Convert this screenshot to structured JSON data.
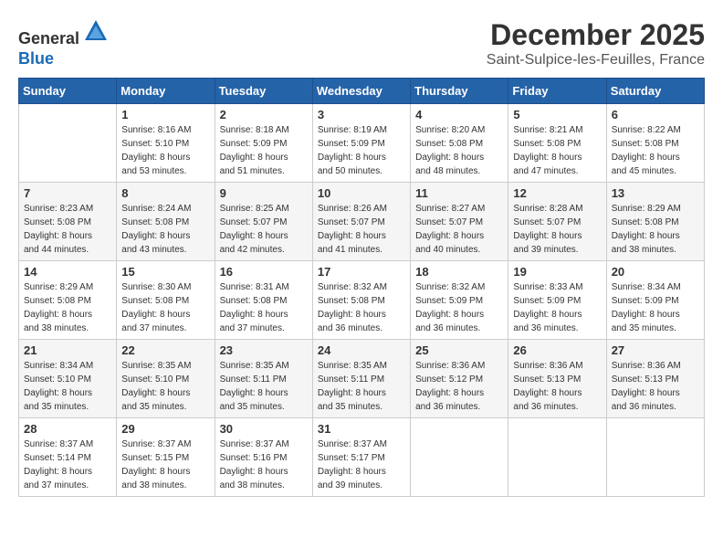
{
  "header": {
    "logo_line1": "General",
    "logo_line2": "Blue",
    "month_title": "December 2025",
    "location": "Saint-Sulpice-les-Feuilles, France"
  },
  "weekdays": [
    "Sunday",
    "Monday",
    "Tuesday",
    "Wednesday",
    "Thursday",
    "Friday",
    "Saturday"
  ],
  "rows": [
    {
      "alt": false,
      "cells": [
        {
          "day": "",
          "info": ""
        },
        {
          "day": "1",
          "info": "Sunrise: 8:16 AM\nSunset: 5:10 PM\nDaylight: 8 hours\nand 53 minutes."
        },
        {
          "day": "2",
          "info": "Sunrise: 8:18 AM\nSunset: 5:09 PM\nDaylight: 8 hours\nand 51 minutes."
        },
        {
          "day": "3",
          "info": "Sunrise: 8:19 AM\nSunset: 5:09 PM\nDaylight: 8 hours\nand 50 minutes."
        },
        {
          "day": "4",
          "info": "Sunrise: 8:20 AM\nSunset: 5:08 PM\nDaylight: 8 hours\nand 48 minutes."
        },
        {
          "day": "5",
          "info": "Sunrise: 8:21 AM\nSunset: 5:08 PM\nDaylight: 8 hours\nand 47 minutes."
        },
        {
          "day": "6",
          "info": "Sunrise: 8:22 AM\nSunset: 5:08 PM\nDaylight: 8 hours\nand 45 minutes."
        }
      ]
    },
    {
      "alt": true,
      "cells": [
        {
          "day": "7",
          "info": "Sunrise: 8:23 AM\nSunset: 5:08 PM\nDaylight: 8 hours\nand 44 minutes."
        },
        {
          "day": "8",
          "info": "Sunrise: 8:24 AM\nSunset: 5:08 PM\nDaylight: 8 hours\nand 43 minutes."
        },
        {
          "day": "9",
          "info": "Sunrise: 8:25 AM\nSunset: 5:07 PM\nDaylight: 8 hours\nand 42 minutes."
        },
        {
          "day": "10",
          "info": "Sunrise: 8:26 AM\nSunset: 5:07 PM\nDaylight: 8 hours\nand 41 minutes."
        },
        {
          "day": "11",
          "info": "Sunrise: 8:27 AM\nSunset: 5:07 PM\nDaylight: 8 hours\nand 40 minutes."
        },
        {
          "day": "12",
          "info": "Sunrise: 8:28 AM\nSunset: 5:07 PM\nDaylight: 8 hours\nand 39 minutes."
        },
        {
          "day": "13",
          "info": "Sunrise: 8:29 AM\nSunset: 5:08 PM\nDaylight: 8 hours\nand 38 minutes."
        }
      ]
    },
    {
      "alt": false,
      "cells": [
        {
          "day": "14",
          "info": "Sunrise: 8:29 AM\nSunset: 5:08 PM\nDaylight: 8 hours\nand 38 minutes."
        },
        {
          "day": "15",
          "info": "Sunrise: 8:30 AM\nSunset: 5:08 PM\nDaylight: 8 hours\nand 37 minutes."
        },
        {
          "day": "16",
          "info": "Sunrise: 8:31 AM\nSunset: 5:08 PM\nDaylight: 8 hours\nand 37 minutes."
        },
        {
          "day": "17",
          "info": "Sunrise: 8:32 AM\nSunset: 5:08 PM\nDaylight: 8 hours\nand 36 minutes."
        },
        {
          "day": "18",
          "info": "Sunrise: 8:32 AM\nSunset: 5:09 PM\nDaylight: 8 hours\nand 36 minutes."
        },
        {
          "day": "19",
          "info": "Sunrise: 8:33 AM\nSunset: 5:09 PM\nDaylight: 8 hours\nand 36 minutes."
        },
        {
          "day": "20",
          "info": "Sunrise: 8:34 AM\nSunset: 5:09 PM\nDaylight: 8 hours\nand 35 minutes."
        }
      ]
    },
    {
      "alt": true,
      "cells": [
        {
          "day": "21",
          "info": "Sunrise: 8:34 AM\nSunset: 5:10 PM\nDaylight: 8 hours\nand 35 minutes."
        },
        {
          "day": "22",
          "info": "Sunrise: 8:35 AM\nSunset: 5:10 PM\nDaylight: 8 hours\nand 35 minutes."
        },
        {
          "day": "23",
          "info": "Sunrise: 8:35 AM\nSunset: 5:11 PM\nDaylight: 8 hours\nand 35 minutes."
        },
        {
          "day": "24",
          "info": "Sunrise: 8:35 AM\nSunset: 5:11 PM\nDaylight: 8 hours\nand 35 minutes."
        },
        {
          "day": "25",
          "info": "Sunrise: 8:36 AM\nSunset: 5:12 PM\nDaylight: 8 hours\nand 36 minutes."
        },
        {
          "day": "26",
          "info": "Sunrise: 8:36 AM\nSunset: 5:13 PM\nDaylight: 8 hours\nand 36 minutes."
        },
        {
          "day": "27",
          "info": "Sunrise: 8:36 AM\nSunset: 5:13 PM\nDaylight: 8 hours\nand 36 minutes."
        }
      ]
    },
    {
      "alt": false,
      "cells": [
        {
          "day": "28",
          "info": "Sunrise: 8:37 AM\nSunset: 5:14 PM\nDaylight: 8 hours\nand 37 minutes."
        },
        {
          "day": "29",
          "info": "Sunrise: 8:37 AM\nSunset: 5:15 PM\nDaylight: 8 hours\nand 38 minutes."
        },
        {
          "day": "30",
          "info": "Sunrise: 8:37 AM\nSunset: 5:16 PM\nDaylight: 8 hours\nand 38 minutes."
        },
        {
          "day": "31",
          "info": "Sunrise: 8:37 AM\nSunset: 5:17 PM\nDaylight: 8 hours\nand 39 minutes."
        },
        {
          "day": "",
          "info": ""
        },
        {
          "day": "",
          "info": ""
        },
        {
          "day": "",
          "info": ""
        }
      ]
    }
  ]
}
